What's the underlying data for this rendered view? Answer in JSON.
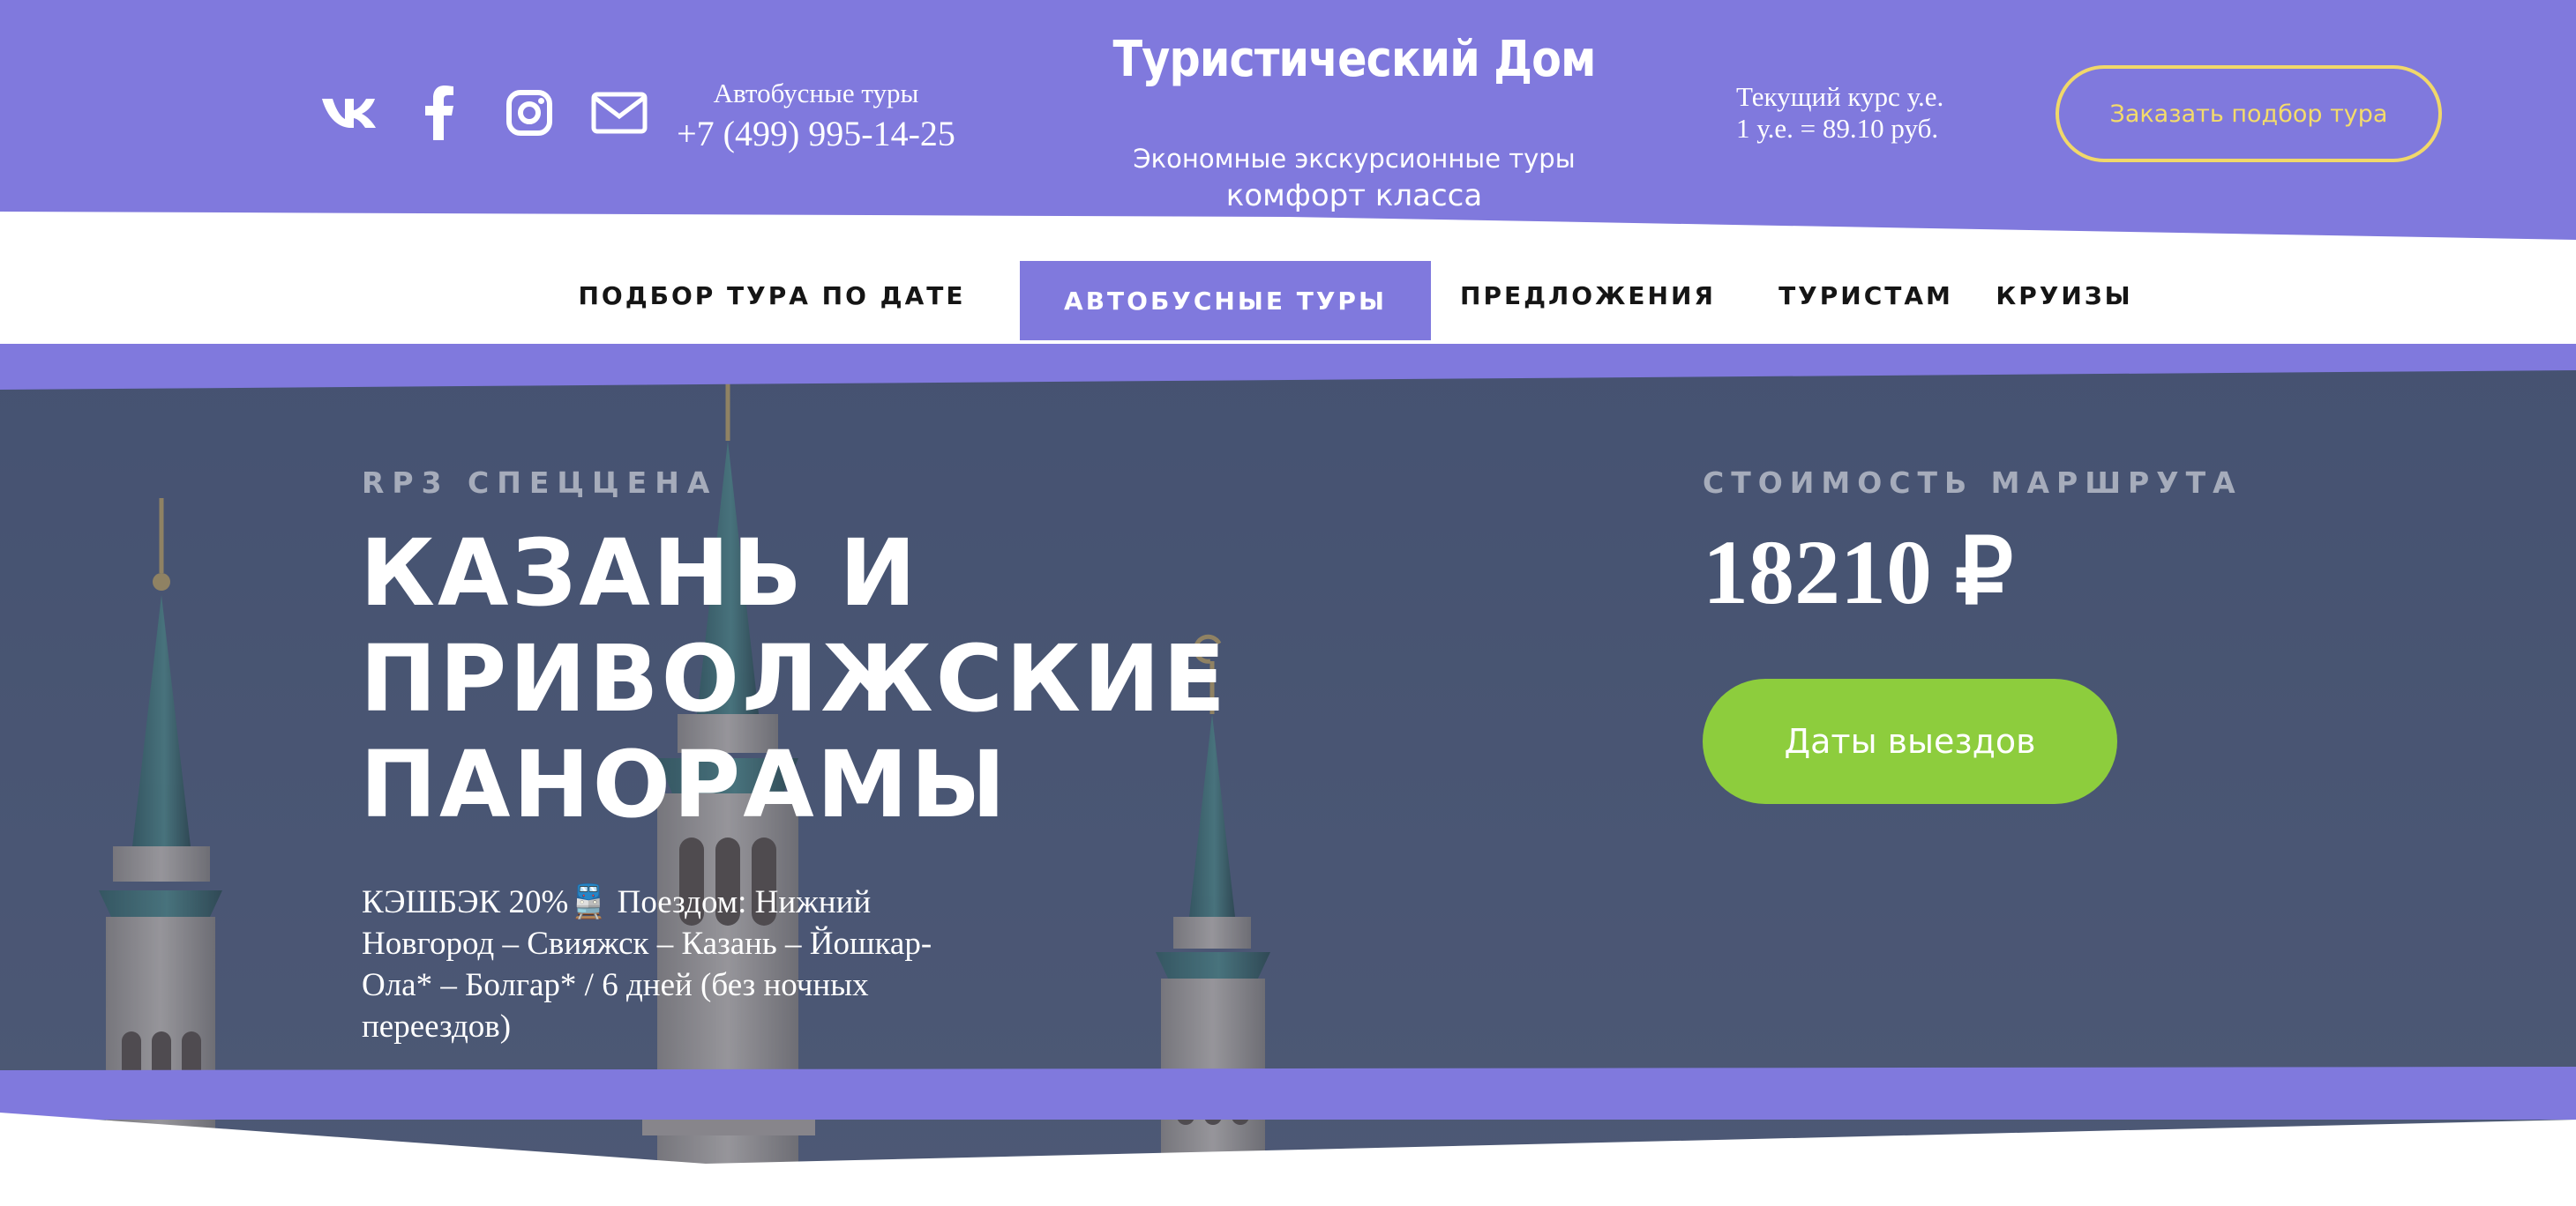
{
  "header": {
    "socials": [
      {
        "icon": "vk-icon",
        "label": "VK"
      },
      {
        "icon": "facebook-icon",
        "label": "Facebook"
      },
      {
        "icon": "instagram-icon",
        "label": "Instagram"
      },
      {
        "icon": "mail-icon",
        "label": "Email"
      }
    ],
    "phone_label": "Автобусные туры",
    "phone_number": "+7 (499) 995-14-25",
    "brand_title": "Туристический Дом",
    "brand_sub1": "Экономные экскурсионные туры",
    "brand_sub2": "комфорт класса",
    "rate_label": "Текущий курс у.е.",
    "rate_value": "1 у.е. = 89.10 руб.",
    "order_button": "Заказать подбор тура"
  },
  "nav": {
    "items": [
      {
        "label": "ПОДБОР ТУРА ПО ДАТЕ",
        "active": false
      },
      {
        "label": "АВТОБУСНЫЕ ТУРЫ",
        "active": true
      },
      {
        "label": "ПРЕДЛОЖЕНИЯ",
        "active": false
      },
      {
        "label": "ТУРИСТАМ",
        "active": false
      },
      {
        "label": "КРУИЗЫ",
        "active": false
      }
    ]
  },
  "hero": {
    "subtitle": "RP3 СПЕЦЦЕНА",
    "title": "КАЗАНЬ И ПРИВОЛЖСКИЕ ПАНОРАМЫ",
    "description": "КЭШБЭК 20%🚆 Поездом: Нижний Новгород – Свияжск – Казань – Йошкар-Ола* – Болгар* / 6 дней (без ночных переездов)",
    "price_label": "СТОИМОСТЬ МАРШРУТА",
    "price_value": "18210 ₽",
    "dates_button": "Даты выездов"
  },
  "colors": {
    "brand_purple": "#8079dd",
    "accent_yellow": "#f1d86a",
    "cta_green": "#8dcd3d",
    "hero_overlay": "#4b5878"
  }
}
